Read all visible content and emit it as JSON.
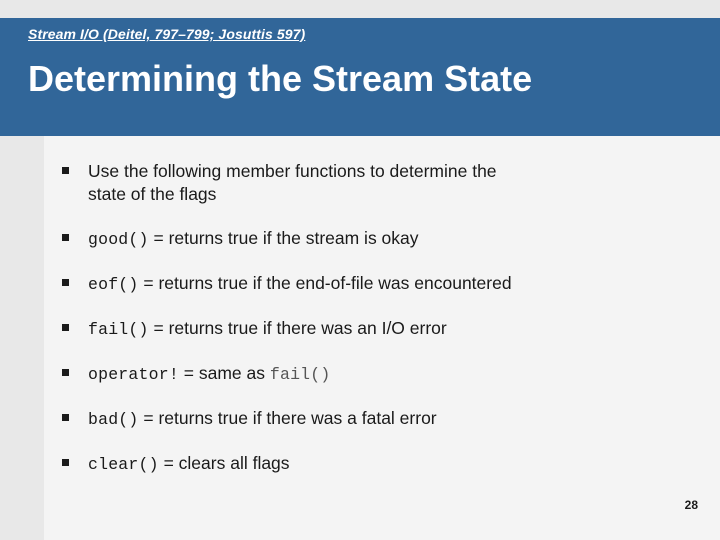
{
  "slide": {
    "kicker": "Stream I/O (Deitel, 797–799; Josuttis 597)",
    "title": "Determining the Stream State",
    "page_number": "28",
    "colors": {
      "header_blue": "#316699",
      "accent_green_dark": "#3aa873",
      "accent_green_light": "#a6d9be",
      "gutter_gray": "#e8e8e8",
      "content_gray": "#f4f4f4",
      "text_black": "#1a1a1a",
      "code_dim": "#555555"
    },
    "bullets": [
      {
        "marker": "square-bullet",
        "line1": "Use the following member functions to determine the",
        "line2": "state of the flags"
      },
      {
        "marker": "square-bullet",
        "code": "good()",
        "text": " = returns true if the stream is okay"
      },
      {
        "marker": "square-bullet",
        "code": "eof()",
        "text": " = returns true if the end-of-file was encountered"
      },
      {
        "marker": "square-bullet",
        "code": "fail()",
        "text": " = returns true if there was an I/O error"
      },
      {
        "marker": "square-bullet",
        "code": "operator!",
        "text": " = same as ",
        "code_tail": "fail()"
      },
      {
        "marker": "square-bullet",
        "code": "bad()",
        "text": " = returns true if there was a fatal error"
      },
      {
        "marker": "square-bullet",
        "code": "clear()",
        "text": " = clears all flags"
      }
    ]
  }
}
